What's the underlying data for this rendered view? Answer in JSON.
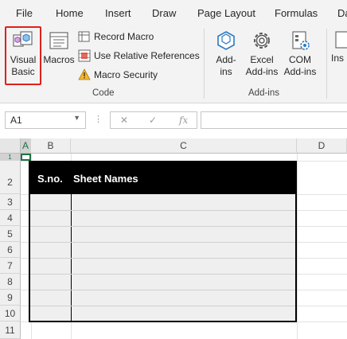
{
  "menu": {
    "tabs": [
      "File",
      "Home",
      "Insert",
      "Draw",
      "Page Layout",
      "Formulas",
      "Da"
    ]
  },
  "ribbon": {
    "code_group": {
      "label": "Code",
      "visual_basic": "Visual Basic",
      "visual_basic_line1": "Visual",
      "visual_basic_line2": "Basic",
      "macros": "Macros",
      "record_macro": "Record Macro",
      "use_relative": "Use Relative References",
      "macro_security": "Macro Security"
    },
    "addins_group": {
      "label": "Add-ins",
      "addins_line1": "Add-",
      "addins_line2": "ins",
      "excel_addins_line1": "Excel",
      "excel_addins_line2": "Add-ins",
      "com_addins_line1": "COM",
      "com_addins_line2": "Add-ins"
    },
    "partial_next_line1": "Ins"
  },
  "formula_bar": {
    "name_box": "A1",
    "cancel_glyph": "✕",
    "enter_glyph": "✓",
    "fx_glyph": "fx",
    "formula": ""
  },
  "sheet": {
    "columns": [
      "A",
      "B",
      "C",
      "D"
    ],
    "rows": [
      "1",
      "2",
      "3",
      "4",
      "5",
      "6",
      "7",
      "8",
      "9",
      "10",
      "11"
    ],
    "table": {
      "headers": [
        "S.no.",
        "Sheet Names"
      ],
      "header_bg": "#000000",
      "body_bg": "#efefef"
    }
  },
  "colors": {
    "highlight": "#e0201b",
    "active_cell": "#1f7244",
    "ribbon_bg": "#f3f3f3"
  }
}
